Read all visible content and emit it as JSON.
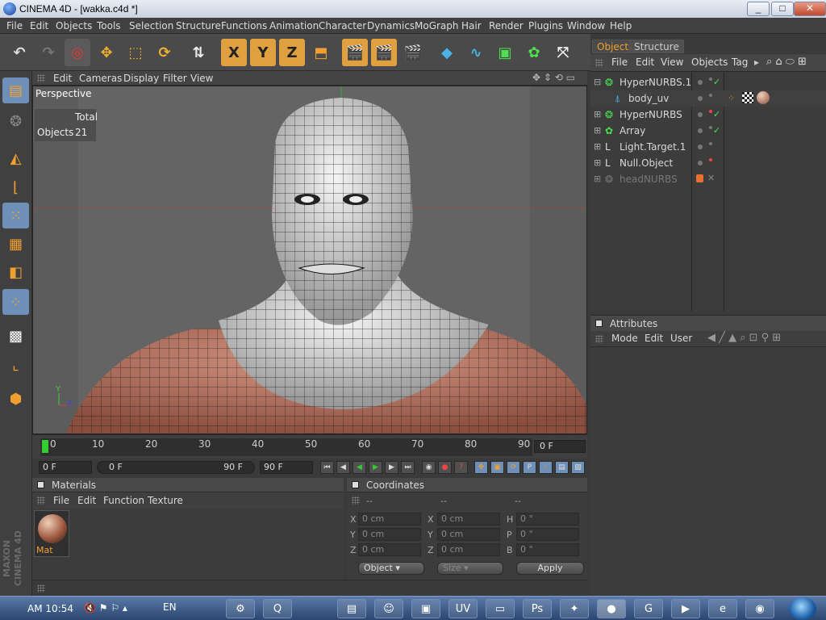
{
  "window": {
    "title": "CINEMA 4D - [wakka.c4d *]",
    "minimize": "_",
    "maximize": "□",
    "close": "✕"
  },
  "menu": [
    "File",
    "Edit",
    "Objects",
    "Tools",
    "Selection",
    "Structure",
    "Functions",
    "Animation",
    "Character",
    "Dynamics",
    "MoGraph",
    "Hair",
    "Render",
    "Plugins",
    "Window",
    "Help"
  ],
  "toolbar": {
    "icons": [
      "undo-icon",
      "redo-icon",
      "live-selection-icon",
      "move-icon",
      "scale-icon",
      "rotate-icon",
      "coordinate-system-icon",
      "x-axis-lock-icon",
      "y-axis-lock-icon",
      "z-axis-lock-icon",
      "world-coordinates-icon",
      "render-view-icon",
      "render-picture-viewer-icon",
      "render-settings-icon",
      "cube-primitive-icon",
      "spline-pen-icon",
      "nurbs-icon",
      "modeling-array-icon",
      "deformer-icon",
      "camera-icon"
    ],
    "labels": {
      "x": "X",
      "y": "Y",
      "z": "Z"
    }
  },
  "left_palette": [
    "make-editable-icon",
    "grid-toggle-icon",
    "model-mode-icon",
    "object-axis-icon",
    "points-mode-icon",
    "edges-mode-icon",
    "polygons-mode-icon",
    "tweak-mode-icon",
    "texture-mode-icon",
    "texture-axis-icon",
    "sculpt-icon"
  ],
  "viewport": {
    "menu": [
      "Edit",
      "Cameras",
      "Display",
      "Filter",
      "View"
    ],
    "camera_label": "Perspective",
    "stats": {
      "header": "Total",
      "label": "Objects",
      "value": "21"
    }
  },
  "timeline": {
    "ticks": [
      "0",
      "10",
      "20",
      "30",
      "40",
      "50",
      "60",
      "70",
      "80",
      "90"
    ],
    "current_frame": "0 F",
    "start_field": "0 F",
    "range_start": "0 F",
    "range_end": "90 F",
    "end_field": "90 F"
  },
  "materials": {
    "title": "Materials",
    "menu": [
      "File",
      "Edit",
      "Function",
      "Texture"
    ],
    "items": [
      {
        "name": "Mat"
      }
    ]
  },
  "coordinates": {
    "title": "Coordinates",
    "headers": [
      "--",
      "--",
      "--"
    ],
    "rows": [
      {
        "a": "X",
        "a_val": "0 cm",
        "b": "X",
        "b_val": "0 cm",
        "c": "H",
        "c_val": "0 °"
      },
      {
        "a": "Y",
        "a_val": "0 cm",
        "b": "Y",
        "b_val": "0 cm",
        "c": "P",
        "c_val": "0 °"
      },
      {
        "a": "Z",
        "a_val": "0 cm",
        "b": "Z",
        "b_val": "0 cm",
        "c": "B",
        "c_val": "0 °"
      }
    ],
    "mode_select": "Object",
    "size_select": "Size",
    "apply": "Apply"
  },
  "objects_panel": {
    "tabs": [
      "Objects",
      "Structure"
    ],
    "menu": [
      "File",
      "Edit",
      "View",
      "Objects",
      "Tag"
    ],
    "items": [
      {
        "name": "HyperNURBS.1",
        "level": 0,
        "check": "✓",
        "dim": false
      },
      {
        "name": "body_uv",
        "level": 1,
        "check": "",
        "dim": false
      },
      {
        "name": "HyperNURBS",
        "level": 0,
        "check": "✓",
        "dim": false
      },
      {
        "name": "Array",
        "level": 0,
        "check": "✓",
        "dim": false
      },
      {
        "name": "Light.Target.1",
        "level": 0,
        "check": "",
        "dim": false
      },
      {
        "name": "Null.Object",
        "level": 0,
        "check": "",
        "dim": false
      },
      {
        "name": "headNURBS",
        "level": 0,
        "check": "",
        "dim": true
      }
    ]
  },
  "attributes_panel": {
    "title": "Attributes",
    "menu": [
      "Mode",
      "Edit",
      "User"
    ]
  },
  "branding": "MAXON CINEMA 4D",
  "taskbar": {
    "time": "AM 10:54",
    "lang": "EN",
    "apps": [
      "explorer-icon",
      "quicktime-icon",
      "office-icon",
      "messenger-icon",
      "ide-icon",
      "uv-icon",
      "folder-icon",
      "photoshop-icon",
      "character-icon",
      "cinema4d-icon",
      "gadget-icon",
      "media-icon",
      "ie-icon",
      "chrome-icon"
    ]
  },
  "colors": {
    "accent": "#e0a040",
    "selection": "#6e8fb8",
    "check": "#4ce24c",
    "panel": "#3c3c3c"
  }
}
